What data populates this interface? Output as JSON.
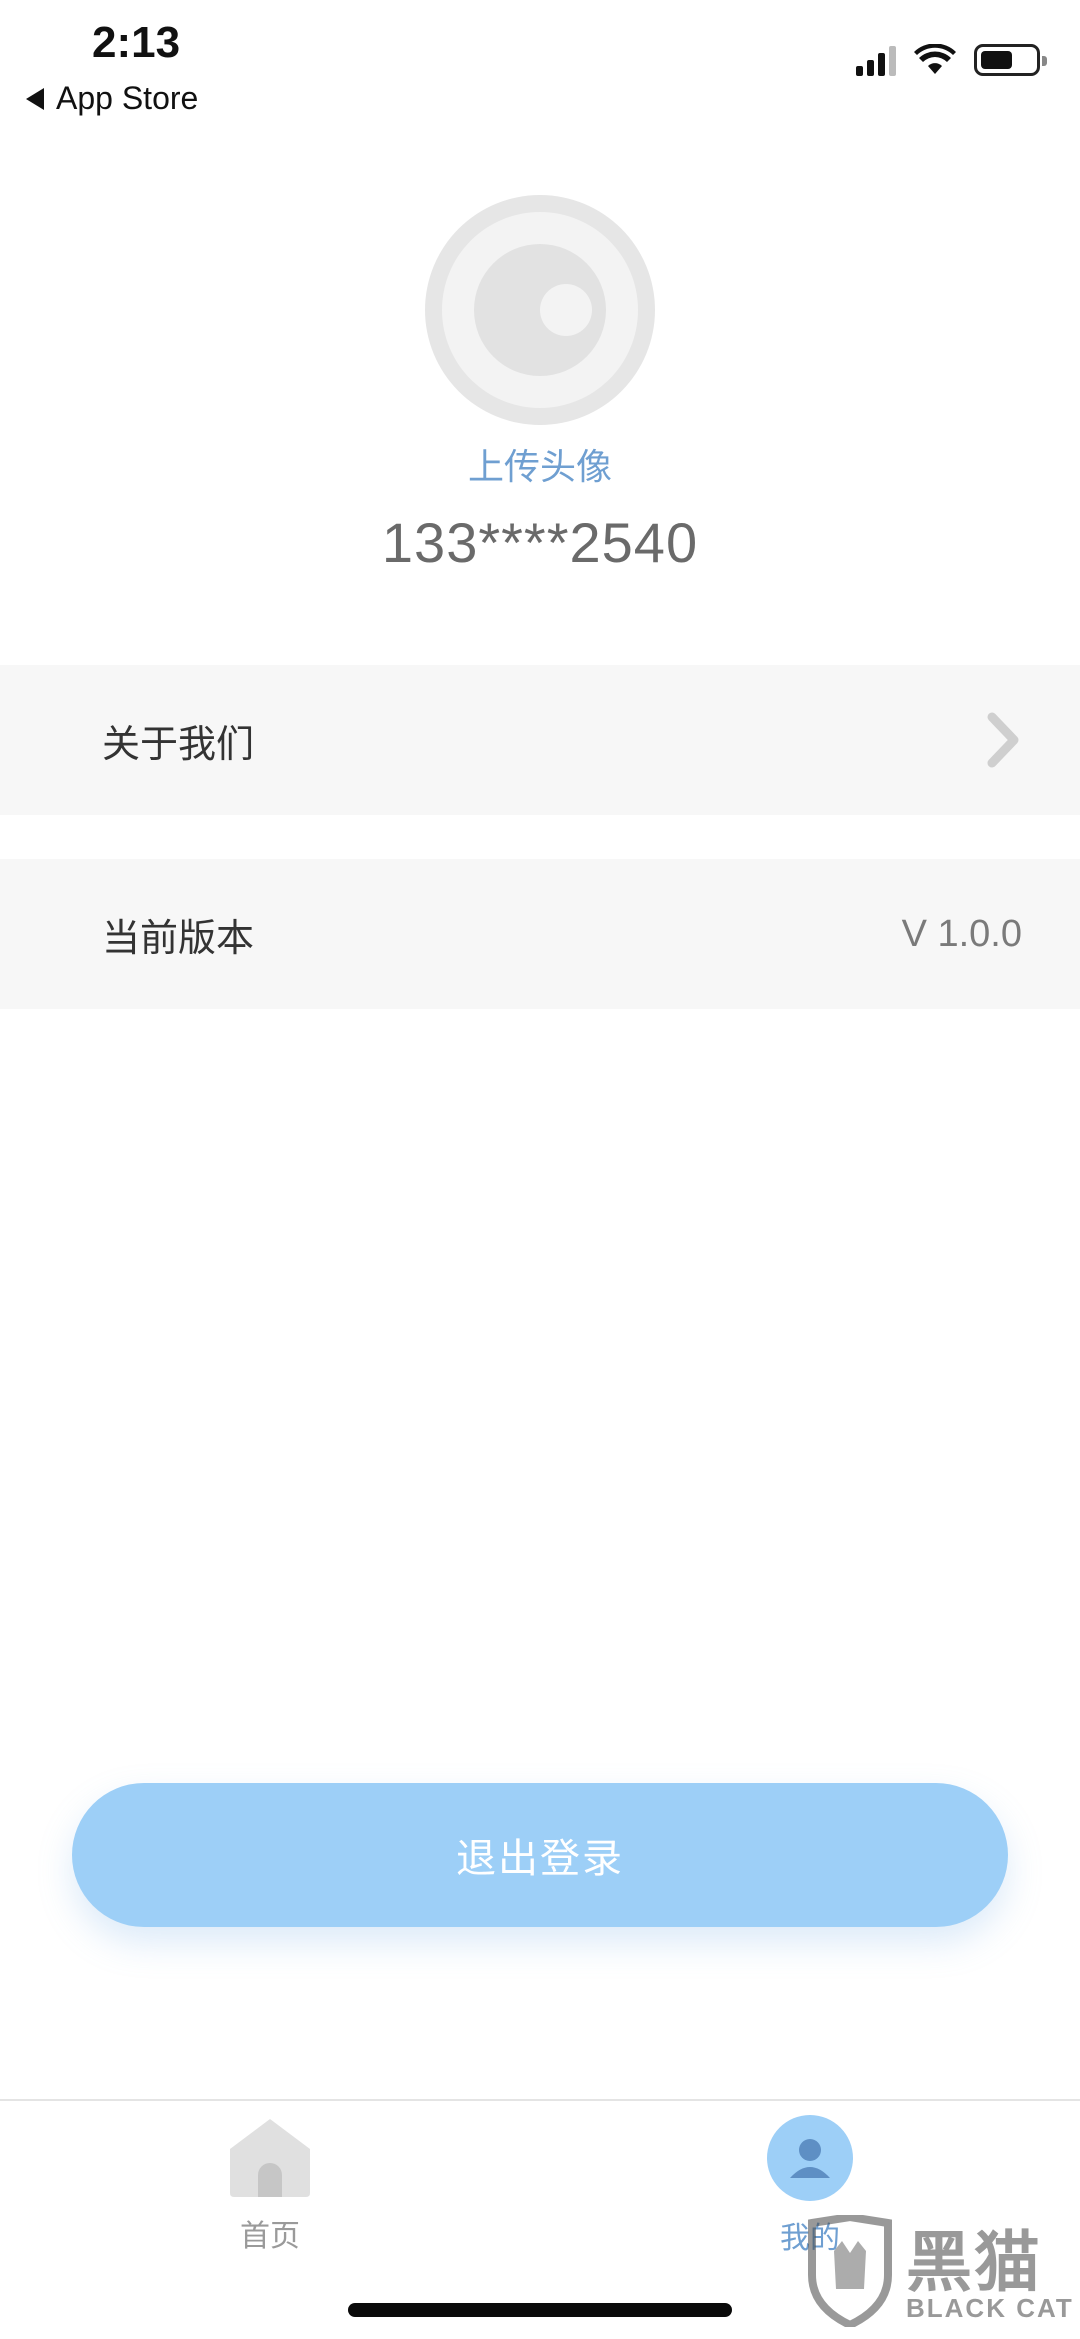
{
  "status_bar": {
    "time": "2:13",
    "back_label": "App Store"
  },
  "profile": {
    "upload_label": "上传头像",
    "phone": "133****2540"
  },
  "menu": {
    "about_label": "关于我们",
    "version_label": "当前版本",
    "version_value": "V 1.0.0"
  },
  "logout_label": "退出登录",
  "tabbar": {
    "home_label": "首页",
    "mine_label": "我的"
  },
  "watermark": {
    "cn": "黑猫",
    "en": "BLACK CAT"
  },
  "colors": {
    "accent": "#9dcff7",
    "link": "#6f9fd1",
    "row_bg": "#f7f7f7"
  }
}
